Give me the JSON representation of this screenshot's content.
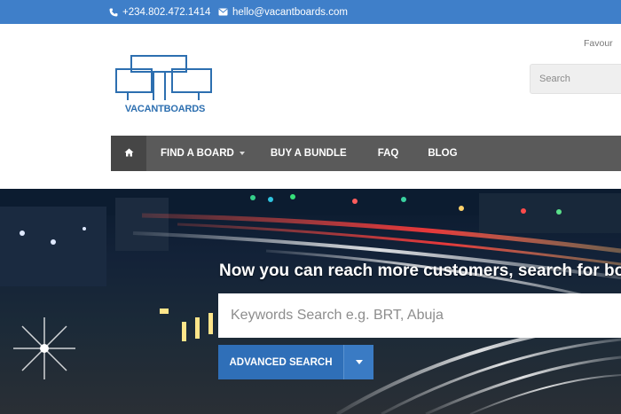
{
  "topbar": {
    "phone": "+234.802.472.1414",
    "email": "hello@vacantboards.com",
    "phone_icon": "phone-icon",
    "email_icon": "envelope-icon",
    "background": "#3f7fc9"
  },
  "header": {
    "logo_text": "VACANTBOARDS",
    "favourites_link": "Favour",
    "search": {
      "placeholder": "Search"
    }
  },
  "nav": {
    "home_icon": "home-icon",
    "items": [
      {
        "label": "FIND A BOARD",
        "has_dropdown": true
      },
      {
        "label": "BUY A BUNDLE",
        "has_dropdown": false
      },
      {
        "label": "FAQ",
        "has_dropdown": false
      },
      {
        "label": "BLOG",
        "has_dropdown": false
      }
    ],
    "background": "#5a5a5a"
  },
  "hero": {
    "headline": "Now you can reach more customers, search for boa",
    "keyword_search": {
      "placeholder": "Keywords Search e.g. BRT, Abuja"
    },
    "advanced_search_label": "ADVANCED SEARCH",
    "advanced_toggle_icon": "chevron-down-icon",
    "button_color": "#2f6fb8"
  }
}
